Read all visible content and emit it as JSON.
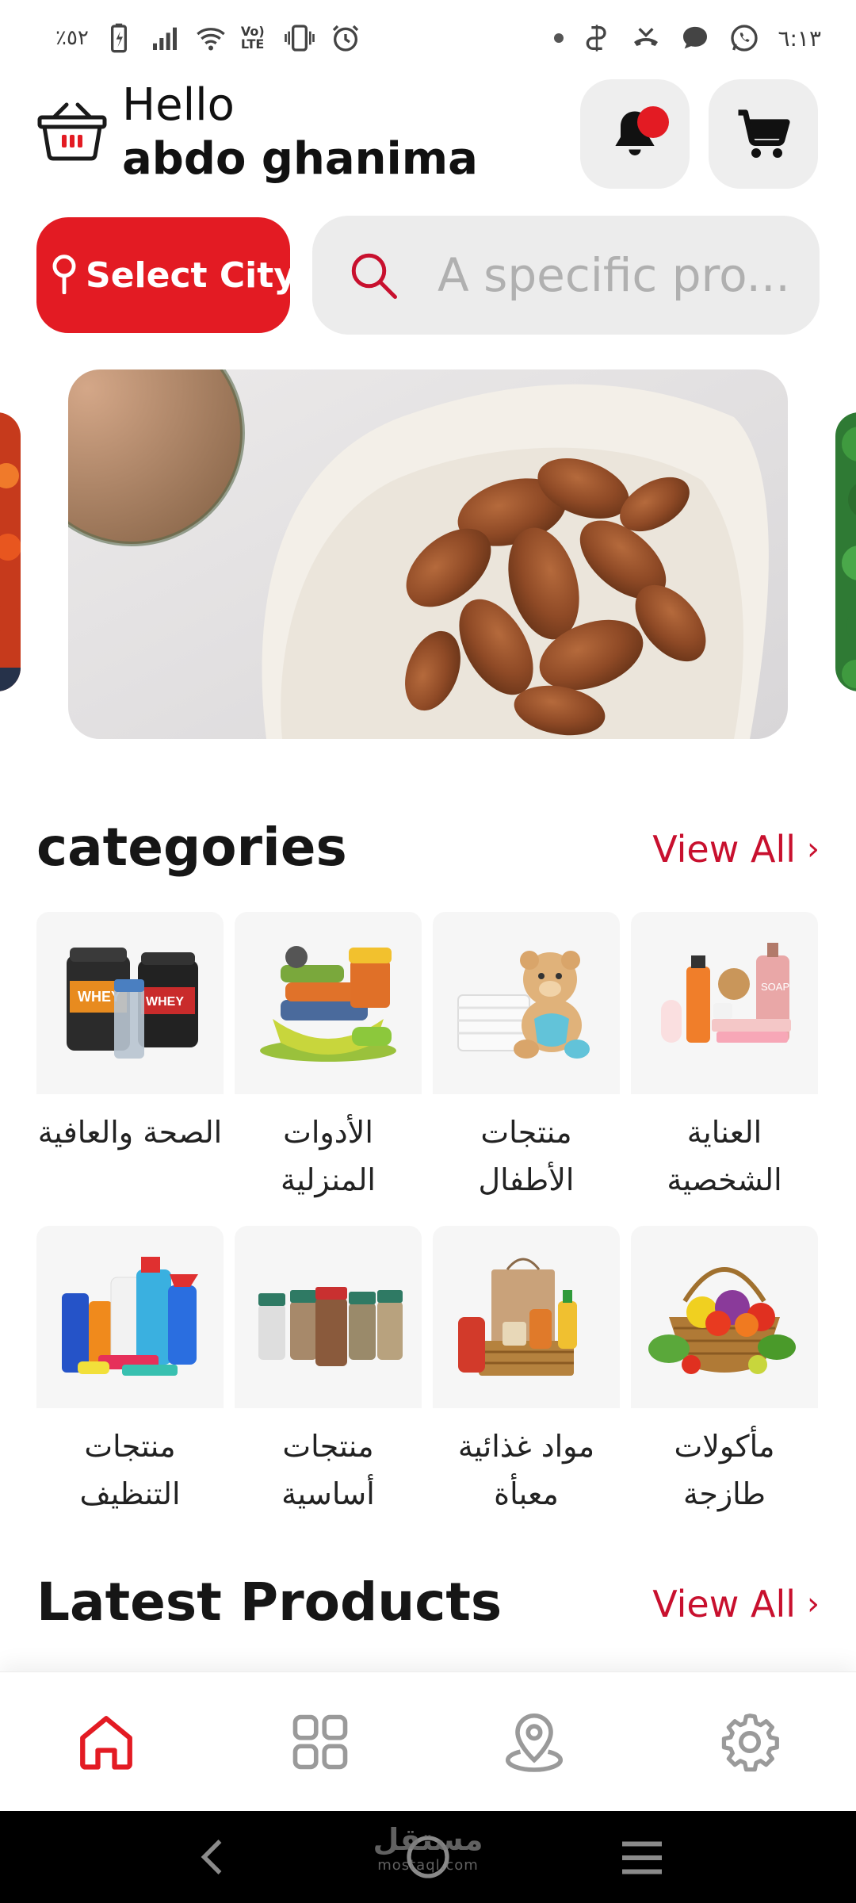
{
  "status_bar": {
    "battery": "٪٥٢",
    "volte": "Vo) LTE",
    "time": "٦:١٣"
  },
  "header": {
    "greeting": "Hello",
    "username": "abdo ghanima"
  },
  "filters": {
    "city_label": "Select City",
    "search_placeholder": "A specific pro..."
  },
  "categories_section": {
    "title": "categories",
    "view_all": "View All",
    "items": [
      {
        "label": "الصحة والعافية",
        "icon": "supplements"
      },
      {
        "label": "الأدوات المنزلية",
        "icon": "kitchenware"
      },
      {
        "label": "منتجات الأطفال",
        "icon": "baby-products"
      },
      {
        "label": "العناية الشخصية",
        "icon": "personal-care"
      },
      {
        "label": "منتجات التنظيف",
        "icon": "cleaning-products"
      },
      {
        "label": "منتجات أساسية",
        "icon": "spices"
      },
      {
        "label": "مواد غذائية معبأة",
        "icon": "groceries"
      },
      {
        "label": "مأكولات طازجة",
        "icon": "fresh-produce"
      }
    ]
  },
  "latest_section": {
    "title": "Latest Products",
    "view_all": "View All"
  },
  "bottom_nav": [
    {
      "name": "home",
      "active": true
    },
    {
      "name": "categories",
      "active": false
    },
    {
      "name": "location",
      "active": false
    },
    {
      "name": "settings",
      "active": false
    }
  ],
  "watermark": {
    "arabic": "مستقل",
    "latin": "mostaql.com"
  },
  "colors": {
    "accent": "#e31b23",
    "link": "#c8102e",
    "card_bg": "#f6f6f6"
  }
}
